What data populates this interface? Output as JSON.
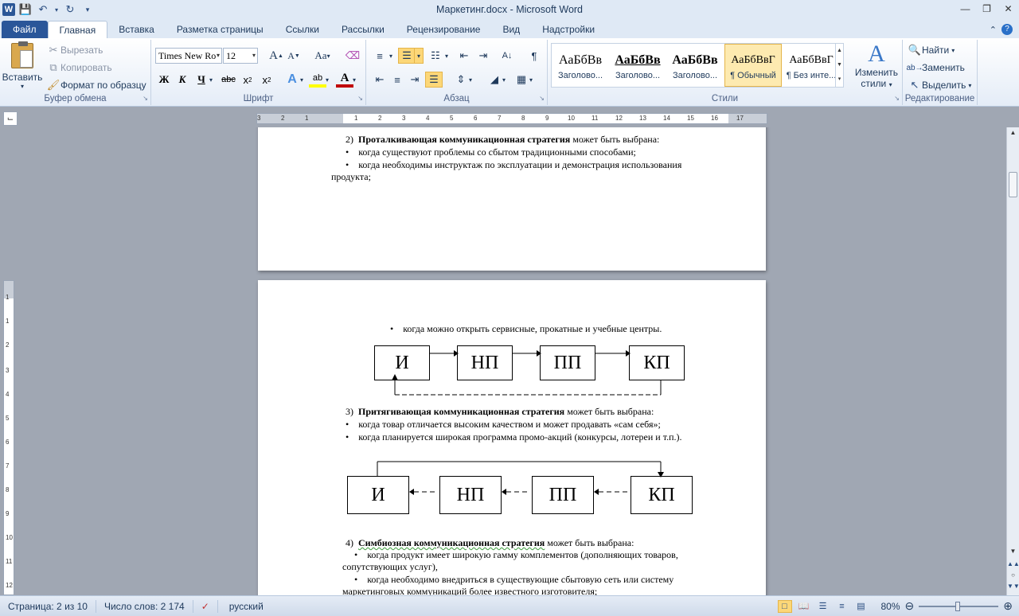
{
  "window": {
    "title": "Маркетинг.docx - Microsoft Word"
  },
  "tabs": [
    "Файл",
    "Главная",
    "Вставка",
    "Разметка страницы",
    "Ссылки",
    "Рассылки",
    "Рецензирование",
    "Вид",
    "Надстройки"
  ],
  "ribbon": {
    "clipboard": {
      "label": "Буфер обмена",
      "paste": "Вставить",
      "cut": "Вырезать",
      "copy": "Копировать",
      "format_painter": "Формат по образцу"
    },
    "font": {
      "label": "Шрифт",
      "font_name": "Times New Ro",
      "font_size": "12",
      "change_case": "Aa",
      "bold": "Ж",
      "italic": "К",
      "underline": "Ч",
      "strike": "abc"
    },
    "paragraph": {
      "label": "Абзац"
    },
    "styles": {
      "label": "Стили",
      "items": [
        {
          "preview": "АаБбВв",
          "name": "Заголово..."
        },
        {
          "preview": "АаБбВв",
          "name": "Заголово..."
        },
        {
          "preview": "АаБбВв",
          "name": "Заголово..."
        },
        {
          "preview": "АаБбВвГ",
          "name": "¶ Обычный"
        },
        {
          "preview": "АаБбВвГ",
          "name": "¶ Без инте..."
        }
      ],
      "change_styles_line1": "Изменить",
      "change_styles_line2": "стили"
    },
    "editing": {
      "label": "Редактирование",
      "find": "Найти",
      "replace": "Заменить",
      "select": "Выделить"
    }
  },
  "ruler": {
    "h_ticks": [
      "3",
      "2",
      "1",
      "1",
      "2",
      "3",
      "4",
      "5",
      "6",
      "7",
      "8",
      "9",
      "10",
      "11",
      "12",
      "13",
      "14",
      "15",
      "16",
      "17"
    ],
    "v_ticks": [
      "1",
      "1",
      "2",
      "3",
      "4",
      "5",
      "6",
      "7",
      "8",
      "9",
      "10",
      "11",
      "12"
    ]
  },
  "document": {
    "page1": {
      "item2_num": "2)",
      "item2_bold": "Проталкивающая коммуникационная стратегия",
      "item2_rest": " может быть выбрана:",
      "b1": "когда существуют проблемы со сбытом традиционными способами;",
      "b2_line1": "когда необходимы инструктаж по эксплуатации и демонстрация использования",
      "b2_line2": "продукта;"
    },
    "page2": {
      "b_service": "когда можно открыть сервисные, прокатные и учебные центры.",
      "diagram1": [
        "И",
        "НП",
        "ПП",
        "КП"
      ],
      "item3_num": "3)",
      "item3_bold": "Притягивающая коммуникационная стратегия",
      "item3_rest": " может быть выбрана:",
      "b3": "когда товар отличается высоким качеством и может продавать «сам себя»;",
      "b4": "когда планируется широкая программа промо-акций (конкурсы, лотереи и т.п.).",
      "diagram2": [
        "И",
        "НП",
        "ПП",
        "КП"
      ],
      "item4_num": "4)",
      "item4_bold": "Симбиозная коммуникационная стратегия",
      "item4_rest": "  может быть выбрана:",
      "b5_line1": "когда продукт имеет широкую гамму комплементов (дополняющих товаров,",
      "b5_line2": "сопутствующих услуг),",
      "b6_line1": "когда необходимо внедриться в существующие сбытовую сеть или систему",
      "b6_line2": "маркетинговых коммуникаций более известного изготовителя;"
    }
  },
  "status": {
    "page": "Страница: 2 из 10",
    "words": "Число слов: 2 174",
    "language": "русский",
    "zoom": "80%"
  }
}
